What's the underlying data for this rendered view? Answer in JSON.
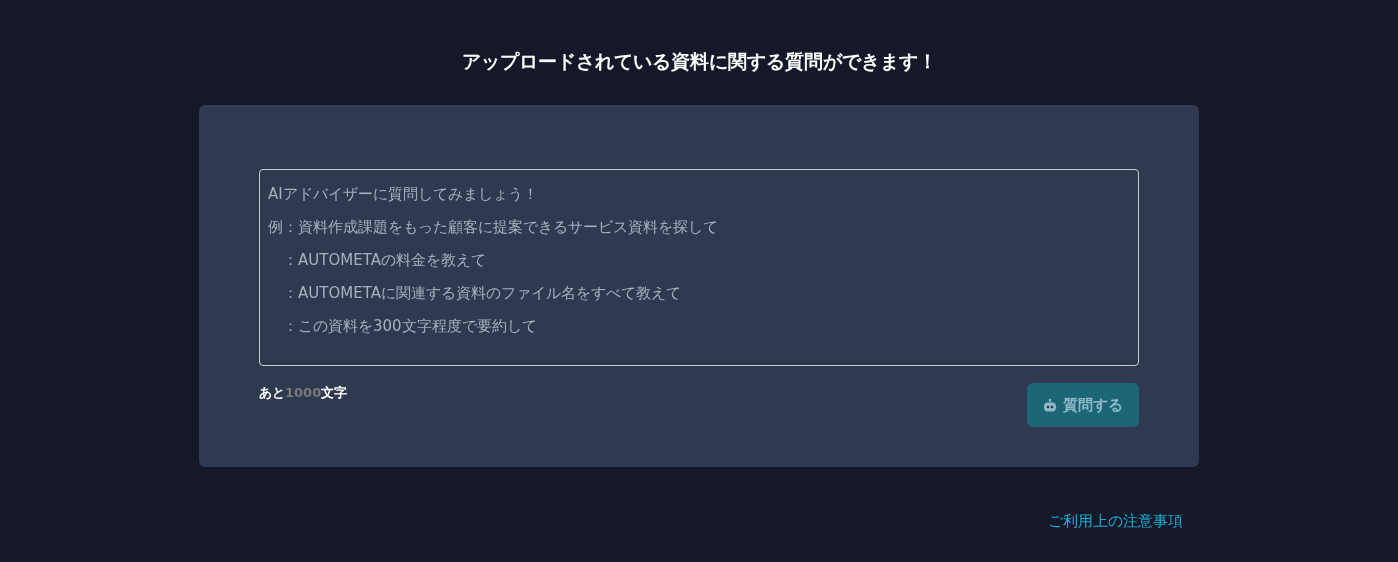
{
  "heading": "アップロードされている資料に関する質問ができます！",
  "question_field": {
    "placeholder_lines": [
      "AIアドバイザーに質問してみましょう！",
      "例：資料作成課題をもった顧客に提案できるサービス資料を探して",
      "　：AUTOMETAの料金を教えて",
      "　：AUTOMETAに関連する資料のファイル名をすべて教えて",
      "　：この資料を300文字程度で要約して"
    ]
  },
  "counter": {
    "prefix": "あと",
    "count": "1000",
    "suffix": "文字"
  },
  "submit_button": {
    "label": "質問する",
    "disabled": true
  },
  "footer_link": "ご利用上の注意事項"
}
